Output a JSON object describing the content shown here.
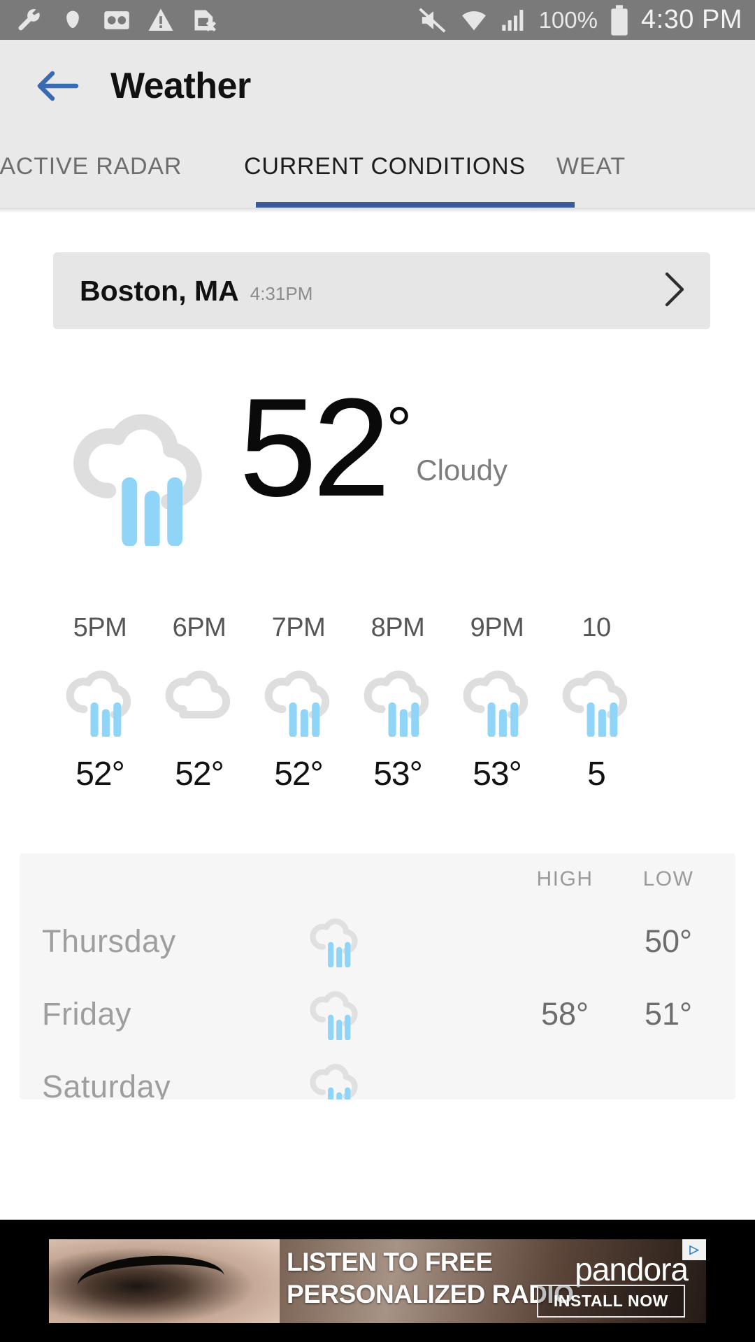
{
  "statusbar": {
    "icons": [
      "wrench-icon",
      "cloud-icon",
      "voicemail-icon",
      "warning-icon",
      "sim-card-error-icon"
    ],
    "right_icons": [
      "mute-icon",
      "wifi-icon",
      "signal-icon"
    ],
    "battery_percent": "100%",
    "clock": "4:30 PM"
  },
  "appbar": {
    "back_icon": "back-arrow-icon",
    "title": "Weather",
    "accent_color": "#3a5a9b"
  },
  "tabs": [
    {
      "label": "RACTIVE RADAR",
      "active": false
    },
    {
      "label": "CURRENT CONDITIONS",
      "active": true
    },
    {
      "label": "WEAT",
      "active": false
    }
  ],
  "location": {
    "name": "Boston, MA",
    "time": "4:31PM",
    "chevron_icon": "chevron-right-icon"
  },
  "current": {
    "icon": "rain-cloud-icon",
    "temperature": "52",
    "degree": "°",
    "description": "Cloudy"
  },
  "hourly": [
    {
      "time": "5PM",
      "icon": "rain-cloud-icon",
      "temp": "52°"
    },
    {
      "time": "6PM",
      "icon": "cloud-icon",
      "temp": "52°"
    },
    {
      "time": "7PM",
      "icon": "rain-cloud-icon",
      "temp": "52°"
    },
    {
      "time": "8PM",
      "icon": "rain-cloud-icon",
      "temp": "53°"
    },
    {
      "time": "9PM",
      "icon": "rain-cloud-icon",
      "temp": "53°"
    },
    {
      "time": "10",
      "icon": "rain-cloud-icon",
      "temp": "5"
    }
  ],
  "daily": {
    "headers": {
      "high": "HIGH",
      "low": "LOW"
    },
    "rows": [
      {
        "day": "Thursday",
        "icon": "rain-cloud-icon",
        "high": "",
        "low": "50°"
      },
      {
        "day": "Friday",
        "icon": "rain-cloud-icon",
        "high": "58°",
        "low": "51°"
      },
      {
        "day": "Saturday",
        "icon": "rain-cloud-icon",
        "high": "",
        "low": ""
      }
    ]
  },
  "ad": {
    "line1": "LISTEN TO FREE",
    "line2": "PERSONALIZED RADIO",
    "brand": "pandora",
    "cta": "INSTALL NOW",
    "adchoices_icon": "adchoices-icon",
    "adchoices_mark": "▷"
  },
  "colors": {
    "rain_blue": "#90d5f7",
    "cloud_gray": "#dedede",
    "tab_accent": "#3a5a9b"
  }
}
